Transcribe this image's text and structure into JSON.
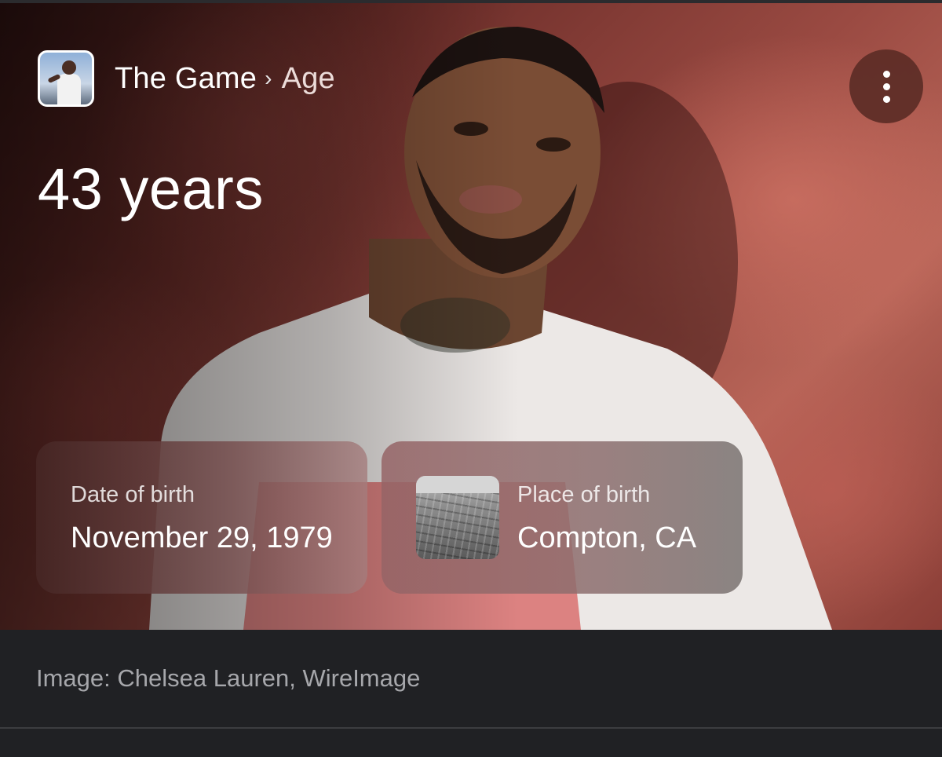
{
  "header": {
    "entity": "The Game",
    "separator": "›",
    "attribute": "Age"
  },
  "answer": {
    "age": "43 years"
  },
  "cards": {
    "date_of_birth": {
      "label": "Date of birth",
      "value": "November 29, 1979"
    },
    "place_of_birth": {
      "label": "Place of birth",
      "value": "Compton, CA"
    }
  },
  "caption": "Image: Chelsea Lauren, WireImage",
  "icons": {
    "more": "more-vert-icon"
  },
  "colors": {
    "page_background": "#202124",
    "caption_text": "#a6a7ab",
    "more_button": "#5c2c26"
  }
}
